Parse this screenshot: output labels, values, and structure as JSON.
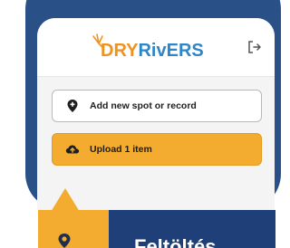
{
  "app": {
    "logo_text": "DRYRivERS"
  },
  "header": {
    "logout_icon": "logout-icon"
  },
  "actions": [
    {
      "label": "Add new spot or record",
      "icon": "map-pin-icon"
    },
    {
      "label": "Upload 1 item",
      "icon": "cloud-upload-icon"
    }
  ],
  "banner": {
    "title": "Feltöltés",
    "icon": "location-pin-icon"
  },
  "colors": {
    "frame": "#2a5088",
    "accent": "#f3ac2f",
    "banner_dark": "#1e3f78",
    "logo_orange": "#f0921e",
    "logo_blue": "#2e86c8"
  }
}
